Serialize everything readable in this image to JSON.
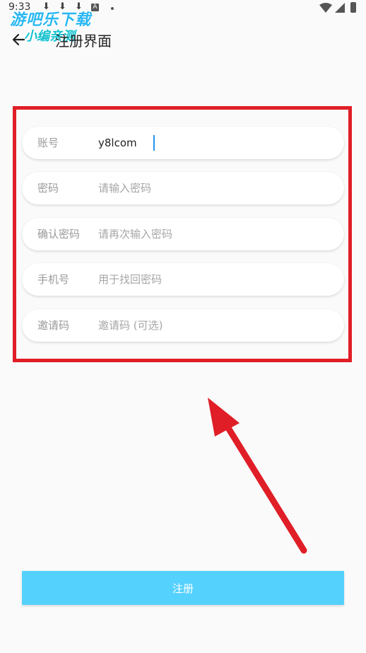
{
  "status_bar": {
    "time": "9:33",
    "notification_badge": "A"
  },
  "watermark": {
    "line1": "游吧乐下载",
    "line2": "小编亲测"
  },
  "header": {
    "title": "注册界面",
    "back_icon": "arrow-left-icon"
  },
  "form": {
    "fields": [
      {
        "label": "账号",
        "value": "y8lcom",
        "placeholder": ""
      },
      {
        "label": "密码",
        "value": "",
        "placeholder": "请输入密码"
      },
      {
        "label": "确认密码",
        "value": "",
        "placeholder": "请再次输入密码"
      },
      {
        "label": "手机号",
        "value": "",
        "placeholder": "用于找回密码"
      },
      {
        "label": "邀请码",
        "value": "",
        "placeholder": "邀请码 (可选)"
      }
    ]
  },
  "submit_label": "注册",
  "colors": {
    "accent": "#55d1fe",
    "highlight": "#e01e27",
    "caret": "#2196f3"
  }
}
